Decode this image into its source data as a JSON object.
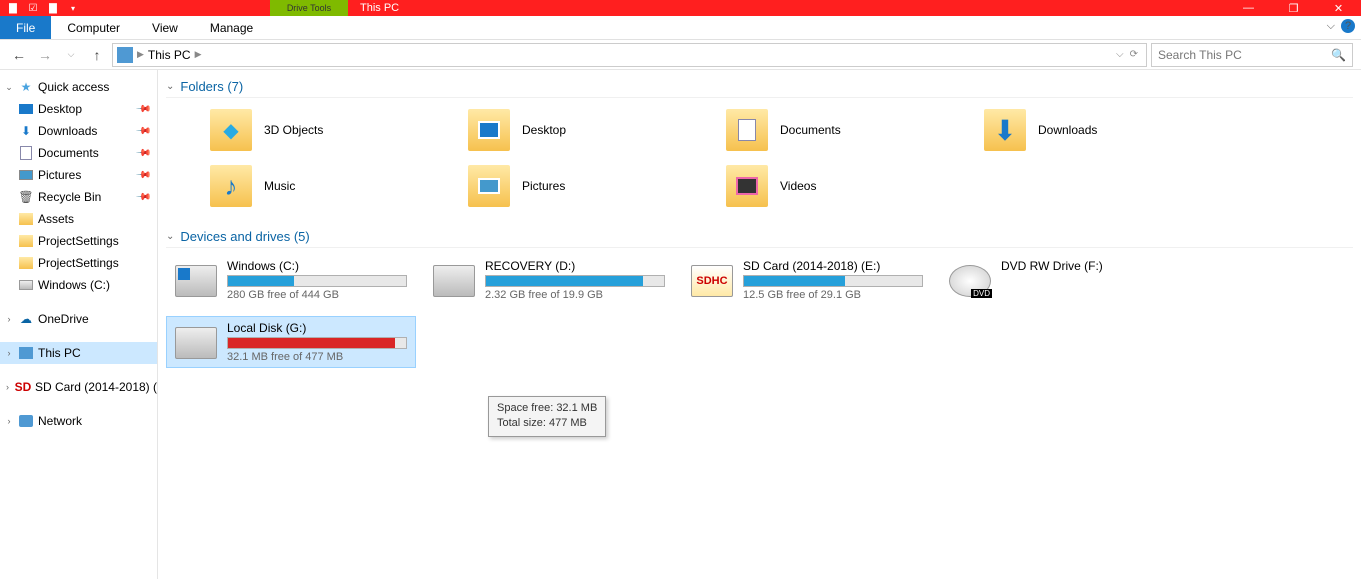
{
  "titlebar": {
    "contextual": "Drive Tools",
    "title": "This PC"
  },
  "ribbon": {
    "file": "File",
    "computer": "Computer",
    "view": "View",
    "manage": "Manage"
  },
  "breadcrumb": {
    "location": "This PC"
  },
  "search": {
    "placeholder": "Search This PC"
  },
  "nav": {
    "quick_access": "Quick access",
    "qa": {
      "desktop": "Desktop",
      "downloads": "Downloads",
      "documents": "Documents",
      "pictures": "Pictures",
      "recycle": "Recycle Bin",
      "assets": "Assets",
      "ps1": "ProjectSettings",
      "ps2": "ProjectSettings",
      "winc": "Windows (C:)"
    },
    "onedrive": "OneDrive",
    "thispc": "This PC",
    "sdcard": "SD Card (2014-2018) (",
    "network": "Network"
  },
  "groups": {
    "folders": "Folders (7)",
    "devices": "Devices and drives (5)"
  },
  "folders": {
    "obj3d": "3D Objects",
    "desktop": "Desktop",
    "documents": "Documents",
    "downloads": "Downloads",
    "music": "Music",
    "pictures": "Pictures",
    "videos": "Videos"
  },
  "drives": {
    "c": {
      "name": "Windows (C:)",
      "free": "280 GB free of 444 GB",
      "pct": 37
    },
    "d": {
      "name": "RECOVERY (D:)",
      "free": "2.32 GB free of 19.9 GB",
      "pct": 88
    },
    "e": {
      "name": "SD Card (2014-2018) (E:)",
      "free": "12.5 GB free of 29.1 GB",
      "pct": 57
    },
    "f": {
      "name": "DVD RW Drive (F:)"
    },
    "g": {
      "name": "Local Disk (G:)",
      "free": "32.1 MB free of 477 MB",
      "pct": 94
    }
  },
  "tooltip": {
    "line1": "Space free: 32.1 MB",
    "line2": "Total size: 477 MB"
  }
}
